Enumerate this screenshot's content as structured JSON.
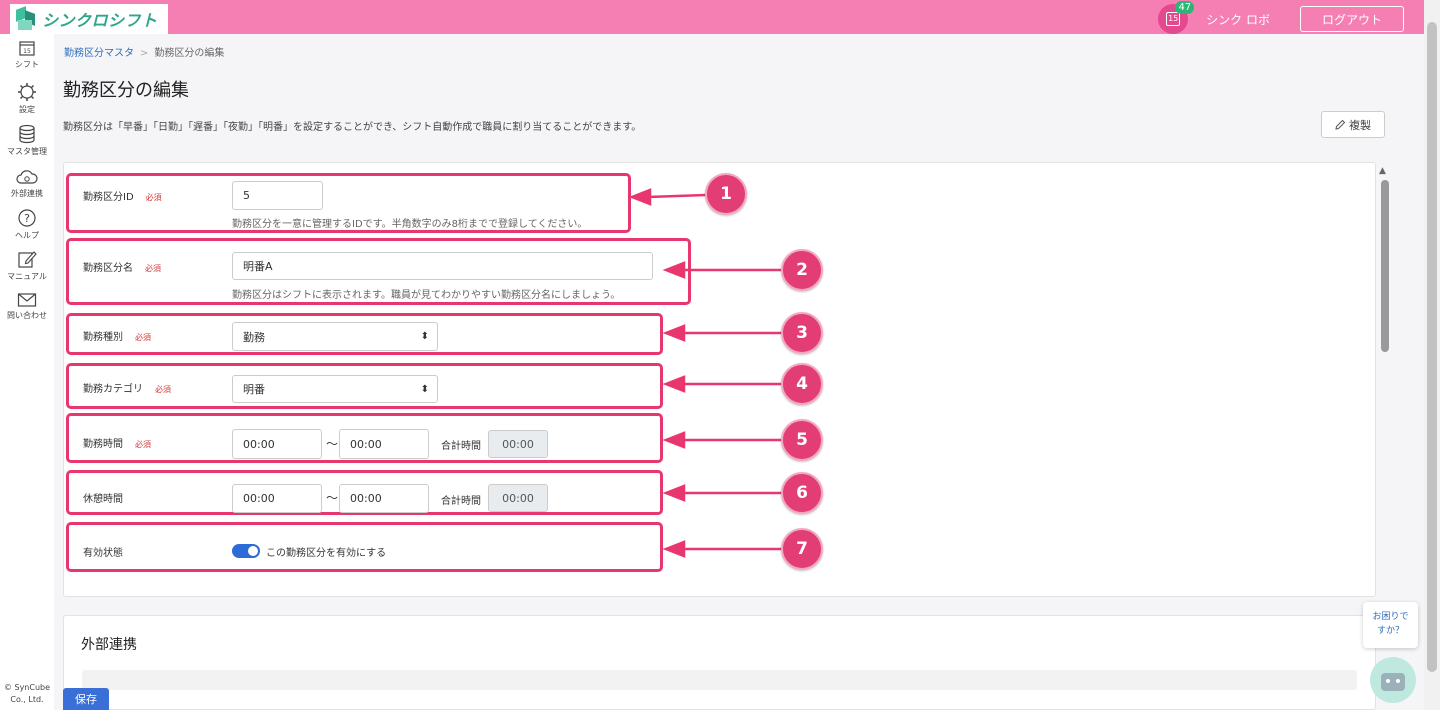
{
  "header": {
    "app_name": "シンクロシフト",
    "notification_count": "47",
    "calendar_day": "15",
    "user_name": "シンク ロボ",
    "logout_label": "ログアウト",
    "bg_color": "#f57fb3"
  },
  "sidebar": {
    "items": [
      {
        "label": "シフト",
        "icon": "calendar-icon"
      },
      {
        "label": "設定",
        "icon": "gear-icon"
      },
      {
        "label": "マスタ管理",
        "icon": "database-icon"
      },
      {
        "label": "外部連携",
        "icon": "cloud-icon"
      },
      {
        "label": "ヘルプ",
        "icon": "help-icon"
      },
      {
        "label": "マニュアル",
        "icon": "edit-icon"
      },
      {
        "label": "問い合わせ",
        "icon": "mail-icon"
      }
    ],
    "calendar_day": "15",
    "copyright_line1": "© SynCube",
    "copyright_line2": "Co., Ltd."
  },
  "breadcrumb": {
    "parent": "勤務区分マスタ",
    "separator": ">",
    "current": "勤務区分の編集"
  },
  "page": {
    "title": "勤務区分の編集",
    "description": "勤務区分は「早番」「日勤」「遅番」「夜勤」「明番」を設定することができ、シフト自動作成で職員に割り当てることができます。",
    "copy_button": "複製"
  },
  "form": {
    "required_tag": "必須",
    "id_label": "勤務区分ID",
    "id_value": "5",
    "id_help": "勤務区分を一意に管理するIDです。半角数字のみ8桁までで登録してください。",
    "name_label": "勤務区分名",
    "name_value": "明番A",
    "name_help": "勤務区分はシフトに表示されます。職員が見てわかりやすい勤務区分名にしましょう。",
    "type_label": "勤務種別",
    "type_value": "勤務",
    "category_label": "勤務カテゴリ",
    "category_value": "明番",
    "work_time_label": "勤務時間",
    "work_start": "00:00",
    "work_end": "00:00",
    "tilde": "～",
    "total_label": "合計時間",
    "work_total": "00:00",
    "break_label": "休憩時間",
    "break_start": "00:00",
    "break_end": "00:00",
    "break_total": "00:00",
    "status_label": "有効状態",
    "status_toggle_label": "この勤務区分を有効にする",
    "status_enabled": true
  },
  "annotations": [
    "1",
    "2",
    "3",
    "4",
    "5",
    "6",
    "7"
  ],
  "external": {
    "title": "外部連携"
  },
  "help_widget": {
    "line1": "お困りで",
    "line2": "すか？"
  },
  "footer": {
    "save_label": "保存"
  },
  "colors": {
    "accent": "#e8376f",
    "link": "#2f6fbd",
    "primary": "#3a6fd8",
    "required": "#d23b3b"
  }
}
